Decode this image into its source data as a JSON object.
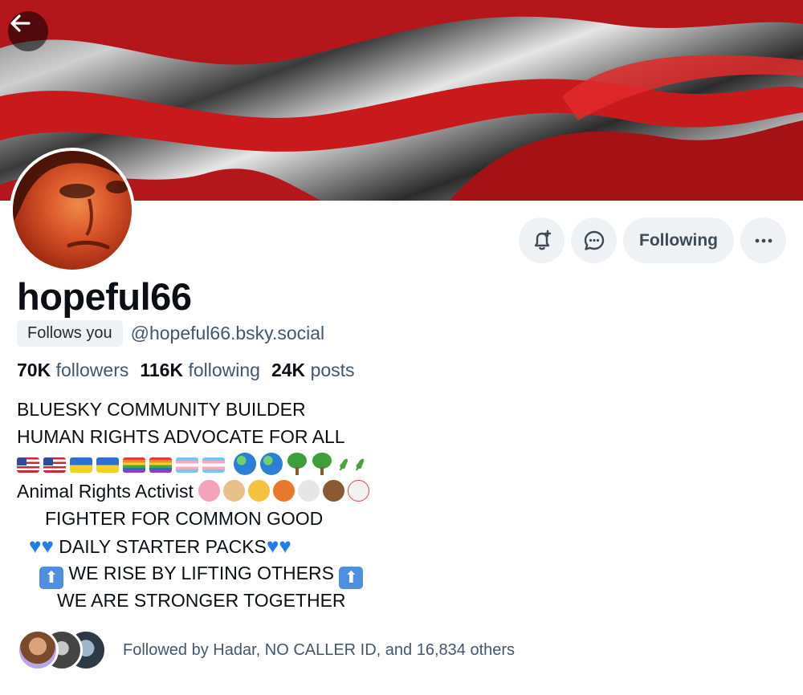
{
  "profile": {
    "display_name": "hopeful66",
    "follows_you_label": "Follows you",
    "handle": "@hopeful66.bsky.social"
  },
  "stats": {
    "followers_count": "70K",
    "followers_label": "followers",
    "following_count": "116K",
    "following_label": "following",
    "posts_count": "24K",
    "posts_label": "posts"
  },
  "actions": {
    "following_label": "Following"
  },
  "bio": {
    "line1": "BLUESKY COMMUNITY BUILDER",
    "line2": "HUMAN RIGHTS ADVOCATE FOR ALL",
    "line4_text": "Animal Rights Activist",
    "line5": "FIGHTER FOR COMMON GOOD",
    "line6": "DAILY STARTER PACKS",
    "line7": "WE RISE BY LIFTING OTHERS",
    "line8": "WE ARE STRONGER TOGETHER"
  },
  "followed_by": {
    "text": "Followed by Hadar, NO CALLER ID, and 16,834 others"
  },
  "icons": {
    "back": "arrow-left-icon",
    "notify": "bell-plus-icon",
    "message": "chat-bubble-icon",
    "more": "ellipsis-icon"
  },
  "colors": {
    "accent_bg": "#eef2f5",
    "muted_text": "#42576c",
    "heart": "#1f7fe6"
  }
}
